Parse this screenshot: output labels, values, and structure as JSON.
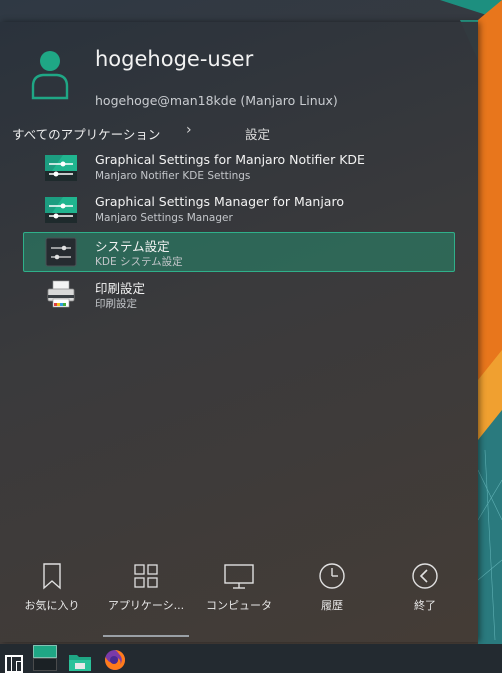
{
  "user": {
    "name": "hogehoge-user",
    "host": "hogehoge@man18kde (Manjaro Linux)"
  },
  "breadcrumb": {
    "root": "すべてのアプリケーション",
    "separator": "›",
    "current": "設定"
  },
  "apps": [
    {
      "title": "Graphical Settings for Manjaro Notifier KDE",
      "subtitle": "Manjaro Notifier KDE Settings",
      "icon": "manjaro-settings-icon",
      "selected": false
    },
    {
      "title": "Graphical Settings Manager for Manjaro",
      "subtitle": "Manjaro Settings Manager",
      "icon": "manjaro-settings-icon",
      "selected": false
    },
    {
      "title": "システム設定",
      "subtitle": "KDE システム設定",
      "icon": "system-settings-icon",
      "selected": true
    },
    {
      "title": "印刷設定",
      "subtitle": "印刷設定",
      "icon": "printer-icon",
      "selected": false
    }
  ],
  "tabs": [
    {
      "label": "お気に入り",
      "icon": "bookmark-icon"
    },
    {
      "label": "アプリケーシ...",
      "icon": "grid-icon"
    },
    {
      "label": "コンピュータ",
      "icon": "monitor-icon"
    },
    {
      "label": "履歴",
      "icon": "clock-icon"
    },
    {
      "label": "終了",
      "icon": "back-arrow-icon"
    }
  ],
  "colors": {
    "accent": "#1fa785",
    "selection_border": "#2fb08a",
    "wallpaper_orange": "#e8761c",
    "wallpaper_teal": "#1d8f7f"
  }
}
